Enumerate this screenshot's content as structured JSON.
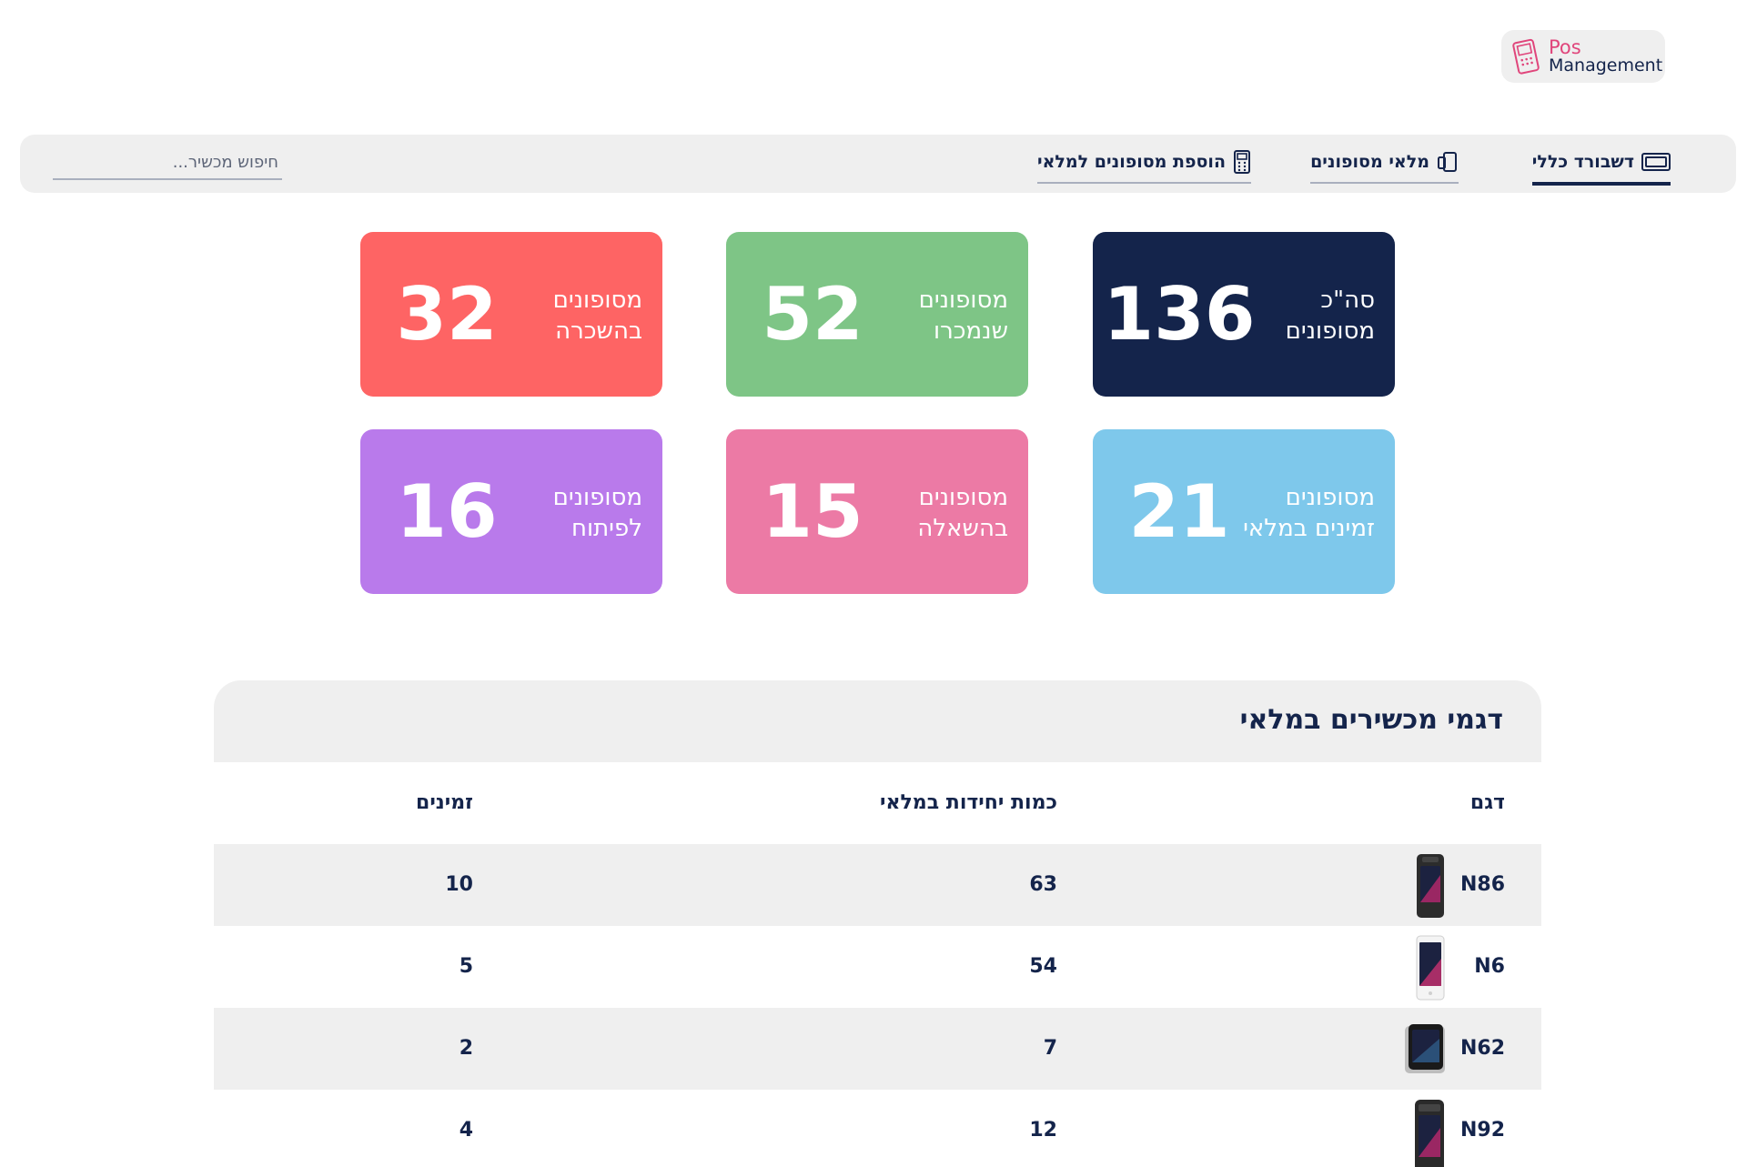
{
  "logo": {
    "line1": "Pos",
    "line2": "Management"
  },
  "nav": {
    "items": [
      {
        "label": "דשבורד כללי",
        "icon": "dashboard-icon",
        "active": true
      },
      {
        "label": "מלאי מסופונים",
        "icon": "devices-icon",
        "active": false
      },
      {
        "label": "הוספת מסופונים למלאי",
        "icon": "pos-terminal-icon",
        "active": false
      }
    ],
    "search_placeholder": "חיפוש מכשיר..."
  },
  "cards": [
    {
      "label": "סה\"כ\nמסופונים",
      "value": "136",
      "color": "#14244b"
    },
    {
      "label": "מסופונים\nשנמכרו",
      "value": "52",
      "color": "#7ec586"
    },
    {
      "label": "מסופונים\nבהשכרה",
      "value": "32",
      "color": "#fe6464"
    },
    {
      "label": "מסופונים\nזמינים במלאי",
      "value": "21",
      "color": "#7ec8eb"
    },
    {
      "label": "מסופונים\nבהשאלה",
      "value": "15",
      "color": "#ec7aa5"
    },
    {
      "label": "מסופונים\nלפיתוח",
      "value": "16",
      "color": "#b97aeb"
    }
  ],
  "table": {
    "title": "דגמי מכשירים במלאי",
    "headers": {
      "model": "דגם",
      "qty": "כמות יחידות במלאי",
      "available": "זמינים"
    },
    "rows": [
      {
        "model": "N86",
        "qty": "63",
        "available": "10"
      },
      {
        "model": "N6",
        "qty": "54",
        "available": "5"
      },
      {
        "model": "N62",
        "qty": "7",
        "available": "2"
      },
      {
        "model": "N92",
        "qty": "12",
        "available": "4"
      }
    ]
  }
}
